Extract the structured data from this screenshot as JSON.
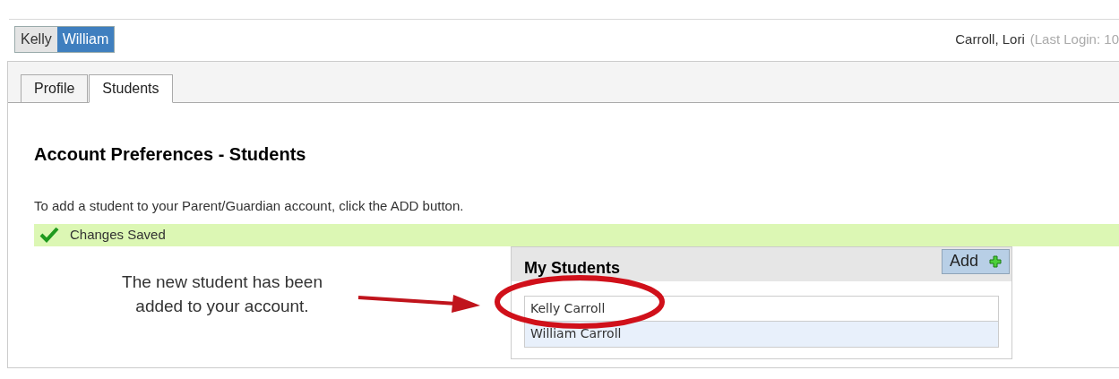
{
  "student_switcher": [
    {
      "label": "Kelly",
      "selected": false
    },
    {
      "label": "William",
      "selected": true
    }
  ],
  "user": {
    "name": "Carroll, Lori",
    "last_login": "(Last Login: 10"
  },
  "tabs": [
    {
      "label": "Profile",
      "selected": false
    },
    {
      "label": "Students",
      "selected": true
    }
  ],
  "heading": "Account Preferences - Students",
  "instruction": "To add a student to your Parent/Guardian account, click the ADD button.",
  "status_message": "Changes Saved",
  "callout": {
    "lines": [
      "The new student has been",
      "added to your account."
    ]
  },
  "my_students": {
    "title": "My Students",
    "add_button": "Add",
    "rows": [
      "Kelly Carroll",
      "William Carroll"
    ]
  }
}
